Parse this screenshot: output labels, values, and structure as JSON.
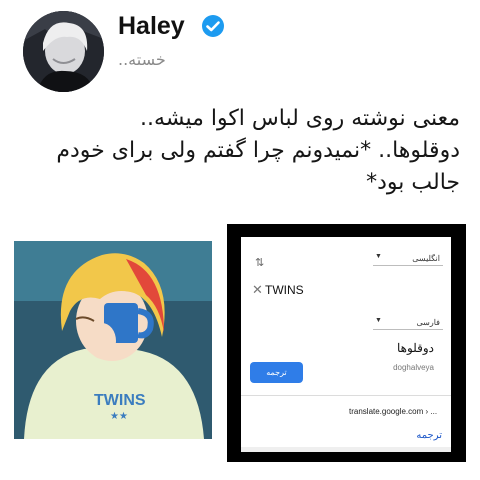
{
  "header": {
    "display_name": "Haley",
    "handle": "خسته..",
    "verified": true,
    "verified_icon": "verified-badge-icon",
    "verified_color": "#1d9bf0"
  },
  "tweet": {
    "lines": [
      "معنی نوشته روی لباس اکوا میشه..",
      "دوقلوها.. *نمیدونم چرا گفتم ولی برای خودم",
      "جالب بود*"
    ]
  },
  "illustration": {
    "shirt_text": "TWINS"
  },
  "translate": {
    "source_language": "انگلیسی",
    "target_language": "فارسی",
    "swap_icon": "swap-arrows-icon",
    "clear_icon": "close-icon",
    "source_text": "TWINS",
    "result_text": "دوقلوها",
    "transliteration": "doghalveya",
    "translate_button": "ترجمه",
    "source_url": "translate.google.com › ...",
    "link_text": "ترجمه",
    "button_color": "#2f7de8"
  }
}
